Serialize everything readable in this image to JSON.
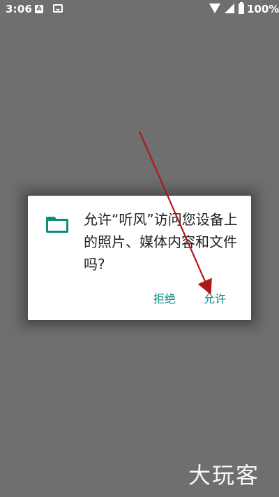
{
  "status_bar": {
    "time": "3:06",
    "notification_a_icon": "A",
    "battery_percent": "100%"
  },
  "dialog": {
    "icon": "folder-icon",
    "message": "允许“听风”访问您设备上的照片、媒体内容和文件吗?",
    "deny_label": "拒绝",
    "allow_label": "允许"
  },
  "watermark": {
    "text": "大玩客"
  },
  "colors": {
    "accent": "#0f8a7e",
    "backdrop": "#6f6f6f",
    "annotation_arrow": "#b01818"
  }
}
